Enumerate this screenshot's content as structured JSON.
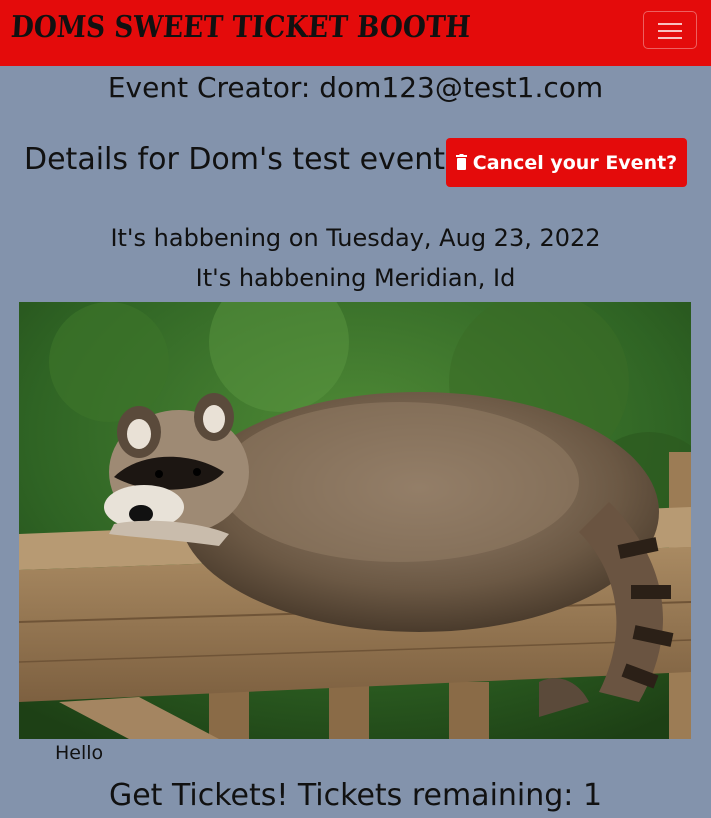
{
  "navbar": {
    "brand": "Doms Sweet Ticket Booth",
    "toggler_icon": "hamburger-icon",
    "color": "#e40b0b"
  },
  "event": {
    "creator_line": "Event Creator: dom123@test1.com",
    "details_title": "Details for Dom's test event",
    "cancel_label": "Cancel your Event?",
    "cancel_icon": "trash-icon",
    "date_line": "It's habbening on Tuesday, Aug 23, 2022",
    "location_line": "It's habbening Meridian, Id",
    "image_alt": "raccoon-on-fence",
    "description": "Hello",
    "tickets_line": "Get Tickets! Tickets remaining: 1"
  },
  "colors": {
    "background": "#8393ac",
    "accent": "#e40b0b"
  }
}
